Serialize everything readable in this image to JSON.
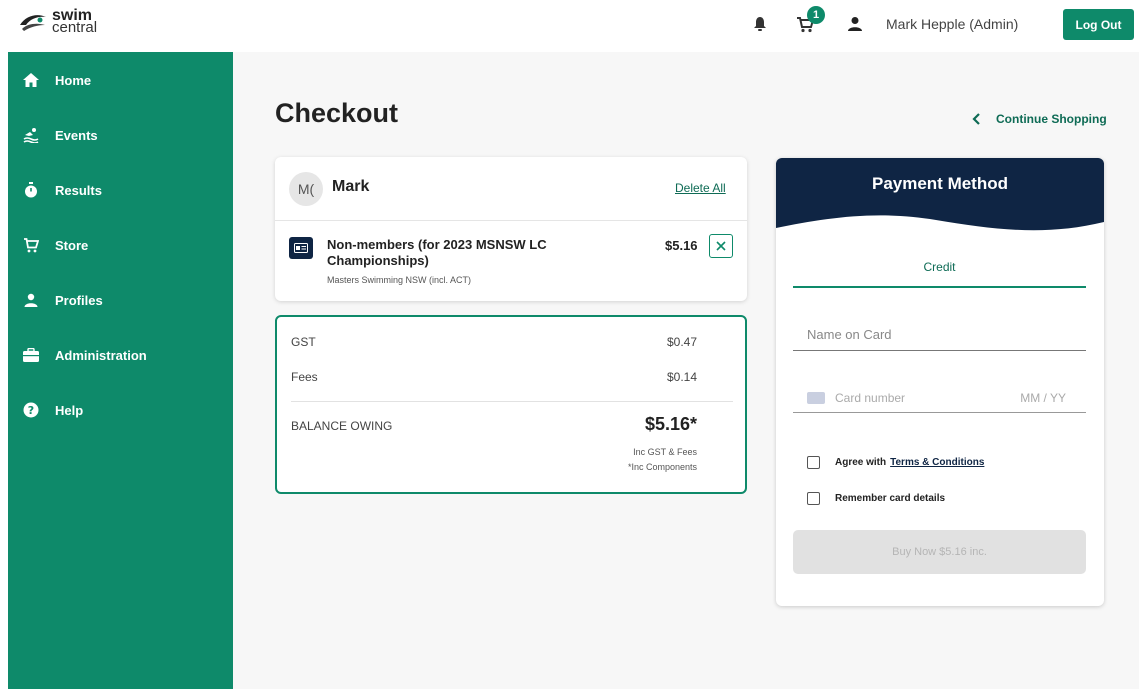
{
  "header": {
    "logo_line1": "swim",
    "logo_line2": "central",
    "cart_count": "1",
    "user_name": "Mark Hepple (Admin)",
    "logout_label": "Log Out"
  },
  "sidebar": {
    "items": [
      {
        "label": "Home",
        "icon": "home-icon"
      },
      {
        "label": "Events",
        "icon": "swimmer-icon"
      },
      {
        "label": "Results",
        "icon": "stopwatch-icon"
      },
      {
        "label": "Store",
        "icon": "cart-icon"
      },
      {
        "label": "Profiles",
        "icon": "person-icon"
      },
      {
        "label": "Administration",
        "icon": "briefcase-icon"
      },
      {
        "label": "Help",
        "icon": "help-icon"
      }
    ]
  },
  "main": {
    "title": "Checkout",
    "continue_shopping": "Continue Shopping"
  },
  "cart": {
    "avatar_initials": "M(",
    "owner": "Mark",
    "delete_all": "Delete All",
    "item": {
      "name": "Non-members (for 2023 MSNSW LC Championships)",
      "organisation": "Masters Swimming NSW (incl. ACT)",
      "price": "$5.16"
    }
  },
  "totals": {
    "gst_label": "GST",
    "gst_value": "$0.47",
    "fees_label": "Fees",
    "fees_value": "$0.14",
    "balance_label": "BALANCE OWING",
    "balance_value": "$5.16*",
    "note1": "Inc GST & Fees",
    "note2": "*Inc Components"
  },
  "payment": {
    "title": "Payment Method",
    "tab": "Credit",
    "name_placeholder": "Name on Card",
    "card_placeholder": "Card number",
    "expiry_placeholder": "MM / YY",
    "agree_label": "Agree with",
    "terms_link": "Terms & Conditions",
    "remember_label": "Remember card details",
    "buy_label": "Buy Now $5.16 inc."
  },
  "colors": {
    "brand_green": "#0e8a6a",
    "navy": "#0f2544"
  }
}
